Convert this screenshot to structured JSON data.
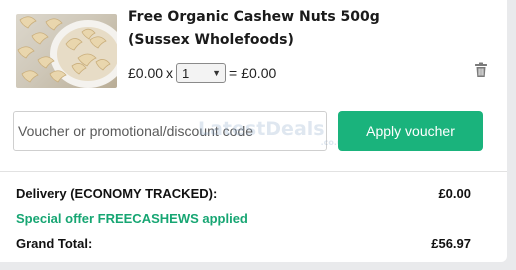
{
  "product": {
    "title": "Free Organic Cashew Nuts 500g (Sussex Wholefoods)",
    "unit_price": "£0.00",
    "times": "x",
    "quantity": "1",
    "equals": "=",
    "line_total": "£0.00"
  },
  "voucher": {
    "placeholder": "Voucher or promotional/discount code",
    "apply_label": "Apply voucher"
  },
  "watermark": {
    "text": "LatestDeals",
    "suffix": ".co.uk"
  },
  "summary": {
    "delivery_label": "Delivery (ECONOMY TRACKED):",
    "delivery_value": "£0.00",
    "offer_text": "Special offer FREECASHEWS applied",
    "total_label": "Grand Total:",
    "total_value": "£56.97"
  },
  "colors": {
    "accent": "#1ab37c",
    "offer_text": "#17a673",
    "background": "#e9eaec"
  },
  "icons": {
    "delete": "trash-icon",
    "dropdown": "chevron-down-icon"
  }
}
